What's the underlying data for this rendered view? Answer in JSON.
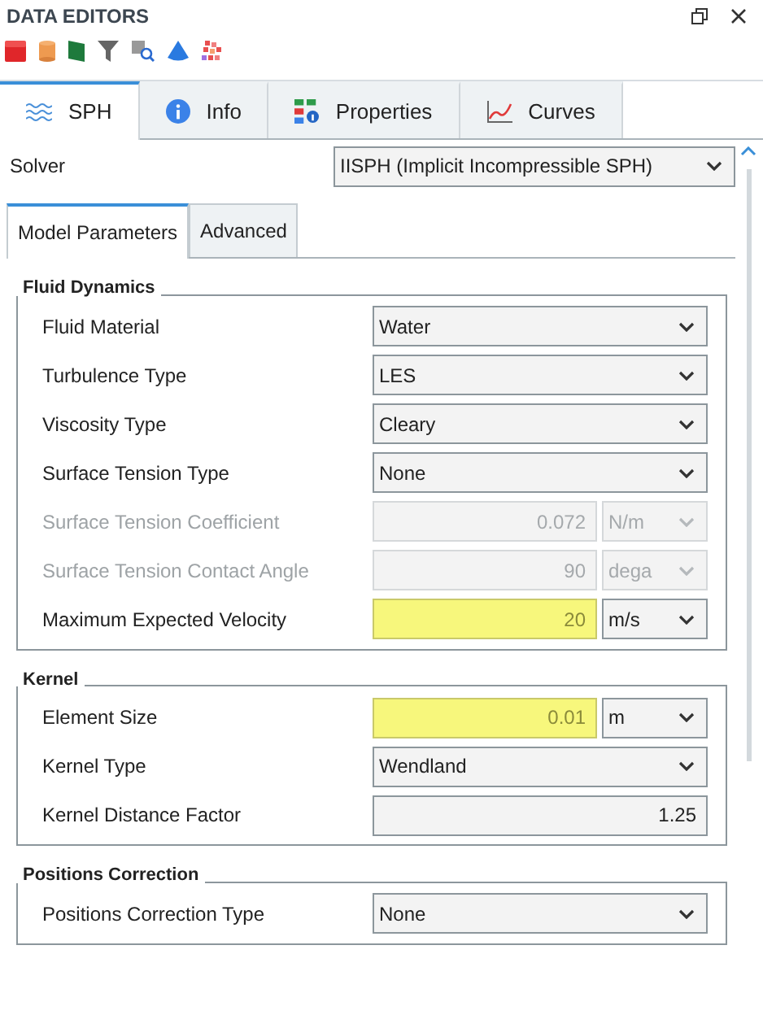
{
  "panel": {
    "title": "DATA EDITORS"
  },
  "tabs": [
    {
      "label": "SPH",
      "selected": true
    },
    {
      "label": "Info",
      "selected": false
    },
    {
      "label": "Properties",
      "selected": false
    },
    {
      "label": "Curves",
      "selected": false
    }
  ],
  "solver": {
    "label": "Solver",
    "value": "IISPH (Implicit Incompressible SPH)"
  },
  "subtabs": [
    {
      "label": "Model Parameters",
      "selected": true
    },
    {
      "label": "Advanced",
      "selected": false
    }
  ],
  "groups": [
    {
      "title": "Fluid Dynamics",
      "rows": [
        {
          "label": "Fluid Material",
          "kind": "select",
          "value": "Water",
          "disabled": false,
          "highlighted": false
        },
        {
          "label": "Turbulence Type",
          "kind": "select",
          "value": "LES",
          "disabled": false,
          "highlighted": false
        },
        {
          "label": "Viscosity Type",
          "kind": "select",
          "value": "Cleary",
          "disabled": false,
          "highlighted": false
        },
        {
          "label": "Surface Tension Type",
          "kind": "select",
          "value": "None",
          "disabled": false,
          "highlighted": false
        },
        {
          "label": "Surface Tension Coefficient",
          "kind": "number",
          "value": "0.072",
          "unit": "N/m",
          "disabled": true,
          "highlighted": false
        },
        {
          "label": "Surface Tension Contact Angle",
          "kind": "number",
          "value": "90",
          "unit": "dega",
          "disabled": true,
          "highlighted": false
        },
        {
          "label": "Maximum Expected Velocity",
          "kind": "number",
          "value": "20",
          "unit": "m/s",
          "disabled": false,
          "highlighted": true
        }
      ]
    },
    {
      "title": "Kernel",
      "rows": [
        {
          "label": "Element Size",
          "kind": "number",
          "value": "0.01",
          "unit": "m",
          "disabled": false,
          "highlighted": true
        },
        {
          "label": "Kernel Type",
          "kind": "select",
          "value": "Wendland",
          "disabled": false,
          "highlighted": false
        },
        {
          "label": "Kernel Distance Factor",
          "kind": "number",
          "value": "1.25",
          "disabled": false,
          "highlighted": false
        }
      ]
    },
    {
      "title": "Positions Correction",
      "rows": [
        {
          "label": "Positions Correction Type",
          "kind": "select",
          "value": "None",
          "disabled": false,
          "highlighted": false
        }
      ]
    }
  ]
}
